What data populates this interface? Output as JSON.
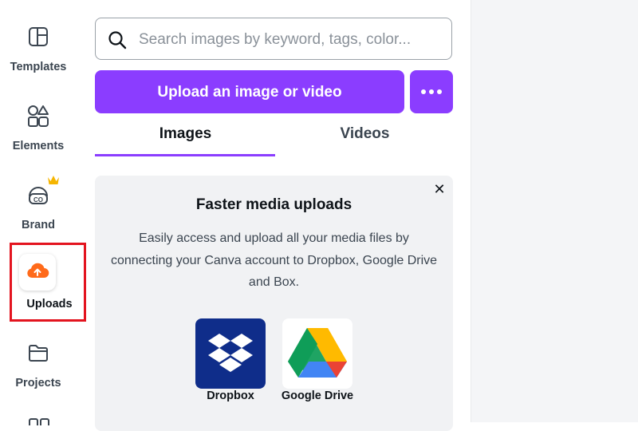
{
  "sidebar": {
    "items": [
      {
        "label": "Templates",
        "icon": "templates-icon"
      },
      {
        "label": "Elements",
        "icon": "elements-icon"
      },
      {
        "label": "Brand",
        "icon": "brand-icon"
      },
      {
        "label": "Uploads",
        "icon": "upload-cloud-icon"
      },
      {
        "label": "Projects",
        "icon": "folder-icon"
      }
    ]
  },
  "panel": {
    "search_placeholder": "Search images by keyword, tags, color...",
    "upload_button_label": "Upload an image or video",
    "tabs": [
      {
        "label": "Images",
        "active": true
      },
      {
        "label": "Videos",
        "active": false
      }
    ],
    "promo": {
      "close_label": "✕",
      "title": "Faster media uploads",
      "body": "Easily access and upload all your media files by connecting your Canva account to Dropbox, Google Drive and Box.",
      "services": [
        {
          "label": "Dropbox"
        },
        {
          "label": "Google Drive"
        }
      ]
    }
  },
  "colors": {
    "accent": "#8b3dff",
    "highlight": "#e3141f",
    "uploads_icon": "#ff6a1a",
    "dropbox_bg": "#0f2d8a",
    "crown": "#f5b500"
  }
}
